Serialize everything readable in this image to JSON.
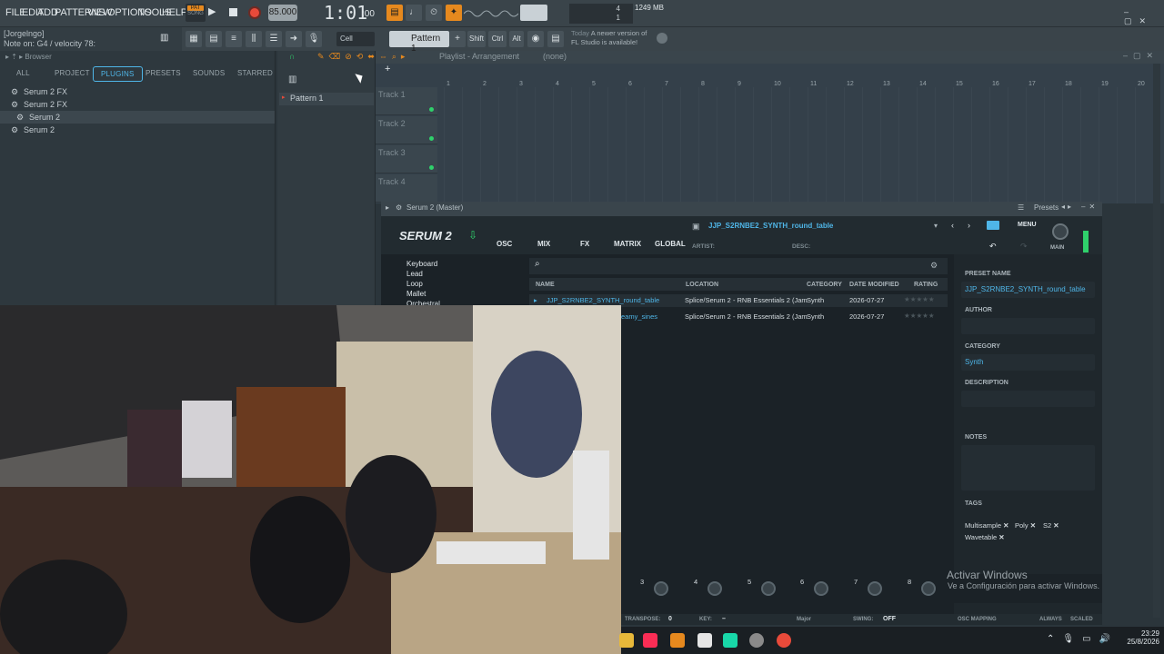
{
  "menu": [
    "FILE",
    "EDIT",
    "ADD",
    "PATTERNS",
    "VIEW",
    "OPTIONS",
    "TOOLS",
    "HELP"
  ],
  "transport": {
    "pat": "PAT",
    "song": "SONG",
    "tempo": "85.000",
    "time": "1:01",
    "time_sub": ":00",
    "mem": "1249 MB",
    "cpu": "4",
    "voices": "1"
  },
  "hint": {
    "user": "[Jorgelngo]",
    "note": "Note on: G4 / velocity 78:"
  },
  "toolbar2": {
    "snap": "Cell",
    "pattern": "Pattern 1",
    "shift": "Shift",
    "ctrl": "Ctrl",
    "alt": "Alt",
    "news_day": "Today",
    "news": "A newer version of FL Studio is available!"
  },
  "browser": {
    "title": "Browser",
    "tabs": [
      "ALL",
      "PROJECT",
      "PLUGINS",
      "PRESETS",
      "SOUNDS",
      "STARRED"
    ],
    "items": [
      "Serum 2 FX",
      "Serum 2 FX",
      "Serum 2",
      "Serum 2"
    ]
  },
  "patterns": {
    "item": "Pattern 1"
  },
  "playlist": {
    "title": "Playlist - Arrangement",
    "sub": "(none)",
    "tracks": [
      "Track 1",
      "Track 2",
      "Track 3",
      "Track 4"
    ],
    "ruler": [
      "1",
      "2",
      "3",
      "4",
      "5",
      "6",
      "7",
      "8",
      "9",
      "10",
      "11",
      "12",
      "13",
      "14",
      "15",
      "16",
      "17",
      "18",
      "19",
      "20"
    ]
  },
  "serum": {
    "window_title": "Serum 2 (Master)",
    "presets_label": "Presets",
    "logo": "SERUM 2",
    "nav": [
      "OSC",
      "MIX",
      "FX",
      "MATRIX",
      "GLOBAL"
    ],
    "preset_name": "JJP_S2RNBE2_SYNTH_round_table",
    "artist_label": "ARTIST:",
    "desc_label": "DESC:",
    "menu": "MENU",
    "main": "MAIN",
    "categories": [
      "Keyboard",
      "Lead",
      "Loop",
      "Mallet",
      "Orchestral"
    ],
    "columns": [
      "NAME",
      "LOCATION",
      "CATEGORY",
      "DATE MODIFIED",
      "RATING"
    ],
    "rows": [
      {
        "name": "JJP_S2RNBE2_SYNTH_round_table",
        "location": "Splice/Serum 2 - RNB Essentials 2 (Jam",
        "category": "Synth",
        "date": "2026-07-27"
      },
      {
        "name": "eamy_sines",
        "location": "Splice/Serum 2 - RNB Essentials 2 (Jam",
        "category": "Synth",
        "date": "2026-07-27"
      }
    ],
    "right": {
      "preset_name_label": "PRESET NAME",
      "preset_name": "JJP_S2RNBE2_SYNTH_round_table",
      "author_label": "AUTHOR",
      "category_label": "CATEGORY",
      "category": "Synth",
      "description_label": "DESCRIPTION",
      "notes_label": "NOTES",
      "tags_label": "TAGS",
      "tags": [
        "Multisample",
        "Poly",
        "S2",
        "Wavetable"
      ]
    },
    "macros": [
      "3",
      "4",
      "5",
      "6",
      "7",
      "8"
    ],
    "bottom": {
      "transpose_label": "TRANSPOSE:",
      "transpose": "0",
      "key_label": "KEY:",
      "key": "–",
      "scale": "Major",
      "swing_label": "SWING:",
      "swing": "OFF",
      "osc_mapping": "OSC MAPPING",
      "always": "ALWAYS",
      "scaled": "SCALED"
    }
  },
  "watermark": {
    "title": "Activar Windows",
    "sub": "Ve a Configuración para activar Windows."
  },
  "taskbar": {
    "time": "23:29",
    "date": "25/8/2026"
  },
  "colors": {
    "accent": "#4fb6e8",
    "green": "#2fd16b",
    "orange": "#e6891e",
    "record": "#e84a3a"
  }
}
